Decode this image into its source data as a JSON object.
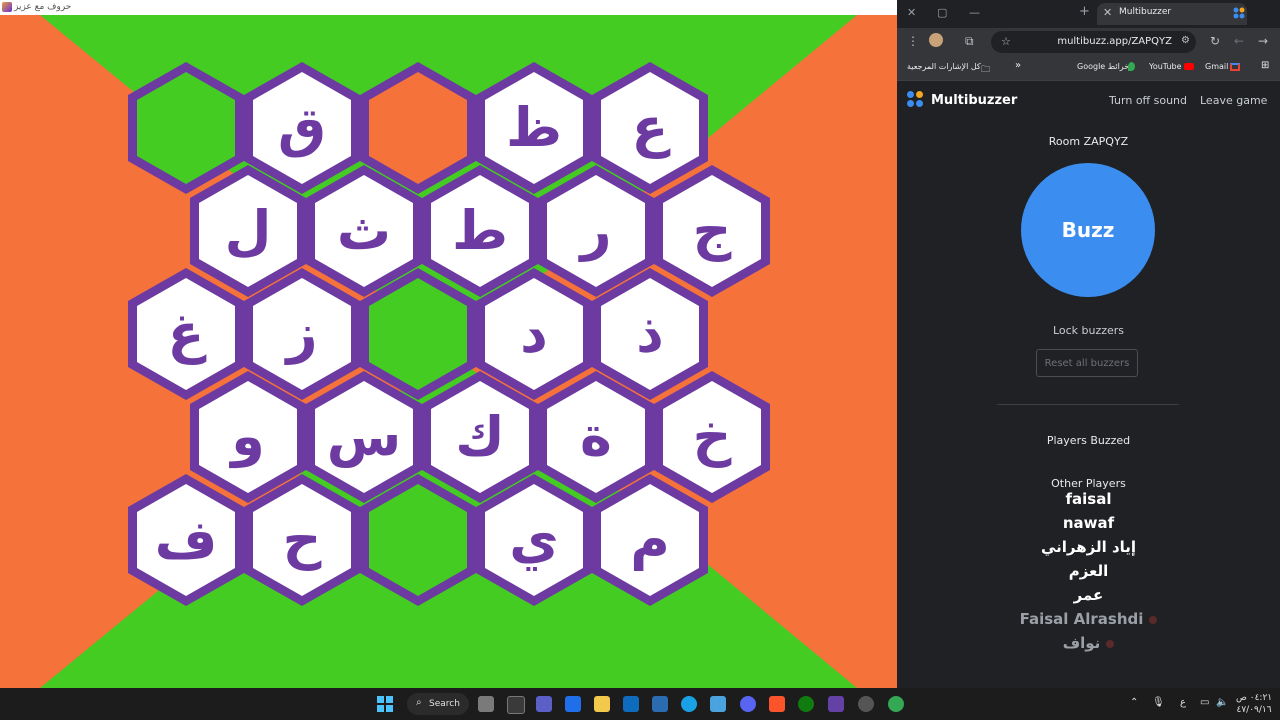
{
  "game": {
    "window_title": "حروف مع عزيز",
    "colors": {
      "green": "#44cc22",
      "orange": "#f5723b",
      "purple": "#6c3aa1",
      "white": "#ffffff"
    },
    "rows": [
      [
        {
          "letter": "",
          "color": "green"
        },
        {
          "letter": "ق",
          "color": "white"
        },
        {
          "letter": "",
          "color": "orange"
        },
        {
          "letter": "ظ",
          "color": "white"
        },
        {
          "letter": "ع",
          "color": "white"
        }
      ],
      [
        {
          "letter": "ل",
          "color": "white"
        },
        {
          "letter": "ث",
          "color": "white"
        },
        {
          "letter": "ط",
          "color": "white"
        },
        {
          "letter": "ر",
          "color": "white"
        },
        {
          "letter": "ج",
          "color": "white"
        }
      ],
      [
        {
          "letter": "غ",
          "color": "white"
        },
        {
          "letter": "ز",
          "color": "white"
        },
        {
          "letter": "",
          "color": "green"
        },
        {
          "letter": "د",
          "color": "white"
        },
        {
          "letter": "ذ",
          "color": "white"
        }
      ],
      [
        {
          "letter": "و",
          "color": "white"
        },
        {
          "letter": "س",
          "color": "white"
        },
        {
          "letter": "ك",
          "color": "white"
        },
        {
          "letter": "ة",
          "color": "white"
        },
        {
          "letter": "خ",
          "color": "white"
        }
      ],
      [
        {
          "letter": "ف",
          "color": "white"
        },
        {
          "letter": "ح",
          "color": "white"
        },
        {
          "letter": "",
          "color": "green"
        },
        {
          "letter": "ي",
          "color": "white"
        },
        {
          "letter": "م",
          "color": "white"
        }
      ]
    ]
  },
  "browser": {
    "tab_title": "Multibuzzer",
    "url": "multibuzz.app/ZAPQYZ",
    "bookmarks": {
      "all_bookmarks": "كل الإشارات المرجعية",
      "google_maps": "Google خرائط",
      "youtube": "YouTube",
      "gmail": "Gmail"
    }
  },
  "multibuzzer": {
    "brand": "Multibuzzer",
    "turn_off_sound": "Turn off sound",
    "leave_game": "Leave game",
    "room": "Room ZAPQYZ",
    "buzz": "Buzz",
    "lock_buzzers": "Lock buzzers",
    "reset_all_buzzers": "Reset all buzzers",
    "players_buzzed_heading": "Players Buzzed",
    "other_players_heading": "Other Players",
    "other_players": [
      {
        "name": "faisal",
        "active": true
      },
      {
        "name": "nawaf",
        "active": true
      },
      {
        "name": "إياد الزهراني",
        "active": true
      },
      {
        "name": "العزم",
        "active": true
      },
      {
        "name": "عمر",
        "active": true
      },
      {
        "name": "Faisal Alrashdi",
        "active": false
      },
      {
        "name": "نواف",
        "active": false
      }
    ]
  },
  "taskbar": {
    "search_label": "Search",
    "language": "ع",
    "time": "٠٤:٢١ ص",
    "date": "٤٧/٠٩/١٦"
  }
}
